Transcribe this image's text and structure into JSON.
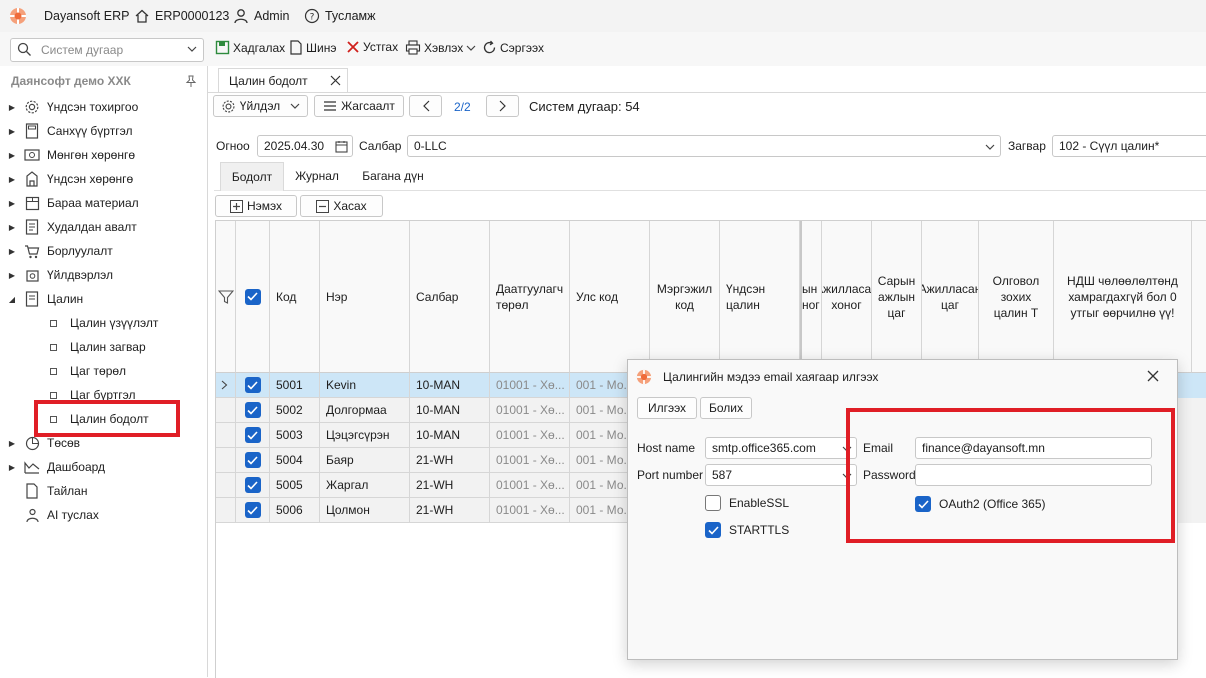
{
  "app": {
    "name": "Dayansoft ERP",
    "doc_id": "ERP0000123",
    "user": "Admin",
    "help": "Тусламж"
  },
  "toolbar": {
    "search_placeholder": "Систем дугаар",
    "save": "Хадгалах",
    "new": "Шинэ",
    "delete": "Устгах",
    "print": "Хэвлэх",
    "refresh": "Сэргээх"
  },
  "sidebar": {
    "company": "Даянсофт демо ХХК",
    "items": [
      {
        "label": "Үндсэн тохиргоо",
        "icon": "gear-icon"
      },
      {
        "label": "Санхүү бүртгэл",
        "icon": "calculator-icon"
      },
      {
        "label": "Мөнгөн хөрөнгө",
        "icon": "money-icon"
      },
      {
        "label": "Үндсэн хөрөнгө",
        "icon": "building-icon"
      },
      {
        "label": "Бараа материал",
        "icon": "package-icon"
      },
      {
        "label": "Худалдан авалт",
        "icon": "purchase-icon"
      },
      {
        "label": "Борлуулалт",
        "icon": "cart-icon"
      },
      {
        "label": "Үйлдвэрлэл",
        "icon": "factory-icon"
      },
      {
        "label": "Цалин",
        "icon": "document-icon"
      }
    ],
    "salary_sub": [
      {
        "label": "Цалин үзүүлэлт"
      },
      {
        "label": "Цалин загвар"
      },
      {
        "label": "Цаг төрөл"
      },
      {
        "label": "Цаг бүртгэл"
      },
      {
        "label": "Цалин бодолт"
      }
    ],
    "items_after": [
      {
        "label": "Төсөв",
        "icon": "pie-icon"
      },
      {
        "label": "Дашбоард",
        "icon": "dashboard-icon"
      },
      {
        "label": "Тайлан",
        "icon": "report-icon"
      },
      {
        "label": "AI туслах",
        "icon": "ai-icon"
      }
    ]
  },
  "tab": {
    "title": "Цалин бодолт"
  },
  "actions": {
    "process": "Үйлдэл",
    "settings": "Жагсаалт",
    "pager": "2/2",
    "system_number_label": "Систем дугаар: 54"
  },
  "form": {
    "date_label": "Огноо",
    "date_value": "2025.04.30",
    "branch_label": "Салбар",
    "branch_value": "0-LLC",
    "template_label": "Загвар",
    "template_value": "102 - Сүүл цалин*"
  },
  "inner_tabs": [
    "Бодолт",
    "Журнал",
    "Багана дүн"
  ],
  "grid_buttons": {
    "add": "Нэмэх",
    "remove": "Хасах"
  },
  "grid": {
    "headers": {
      "code": "Код",
      "name": "Нэр",
      "branch": "Салбар",
      "insurer_type": "Даатгуулагч төрөл",
      "country_code": "Улс код",
      "profession_code": "Мэргэжил код",
      "base_salary": "Үндсэн цалин",
      "partial_col": "ын ног",
      "worked_days": "Ажилласан хоног",
      "month_hours": "Сарын ажлын цаг",
      "worked_hours": "Ажилласан цаг",
      "target_salary": "Олговол зохих цалин Т",
      "tax_exempt": "НДШ чөлөөлөлтөнд хамрагдахгүй бол 0 утгыг өөрчилнө үү!"
    },
    "rows": [
      {
        "code": "5001",
        "name": "Kevin",
        "branch": "10-MAN",
        "insurer": "01001 - Хө...",
        "country": "001 - Мо..."
      },
      {
        "code": "5002",
        "name": "Долгормаа",
        "branch": "10-MAN",
        "insurer": "01001 - Хө...",
        "country": "001 - Мо..."
      },
      {
        "code": "5003",
        "name": "Цэцэгсүрэн",
        "branch": "10-MAN",
        "insurer": "01001 - Хө...",
        "country": "001 - Мо..."
      },
      {
        "code": "5004",
        "name": "Баяр",
        "branch": "21-WH",
        "insurer": "01001 - Хө...",
        "country": "001 - Мо..."
      },
      {
        "code": "5005",
        "name": "Жаргал",
        "branch": "21-WH",
        "insurer": "01001 - Хө...",
        "country": "001 - Мо..."
      },
      {
        "code": "5006",
        "name": "Цолмон",
        "branch": "21-WH",
        "insurer": "01001 - Хө...",
        "country": "001 - Мо..."
      }
    ]
  },
  "dialog": {
    "title": "Цалингийн мэдээ email хаягаар илгээх",
    "send": "Илгээх",
    "cancel": "Болих",
    "host_label": "Host name",
    "host_value": "smtp.office365.com",
    "port_label": "Port number",
    "port_value": "587",
    "enable_ssl": "EnableSSL",
    "starttls": "STARTTLS",
    "email_label": "Email",
    "email_value": "finance@dayansoft.mn",
    "password_label": "Password",
    "password_value": "",
    "oauth_label": "OAuth2 (Office 365)"
  },
  "colors": {
    "accent": "#1a64c8",
    "highlight": "#e01e26",
    "selected_row": "#cde6f7"
  }
}
